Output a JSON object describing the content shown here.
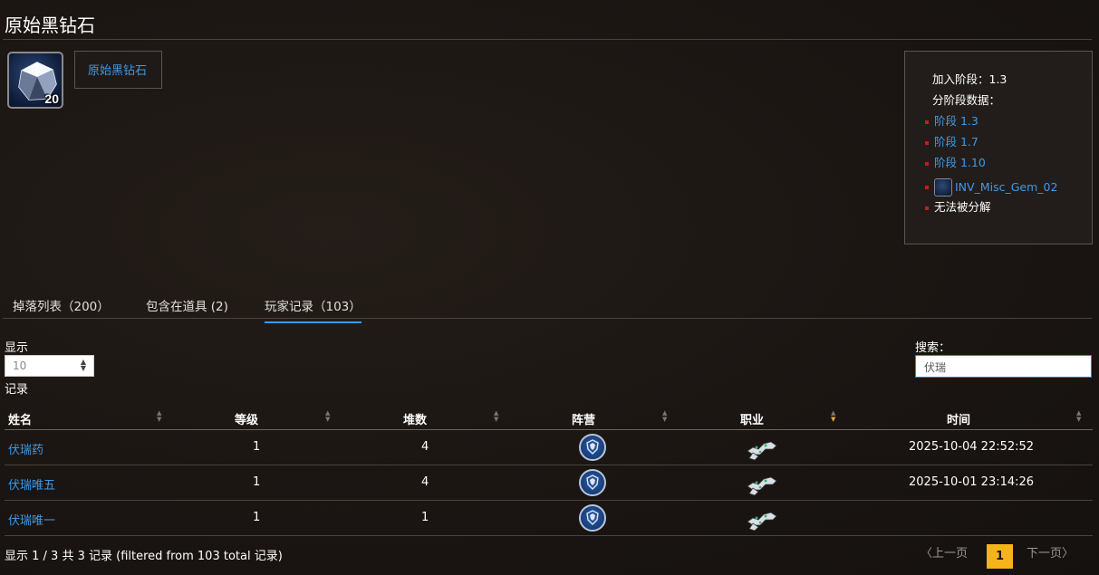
{
  "page_title": "原始黑钻石",
  "item": {
    "stack_count": "20",
    "name": "原始黑钻石",
    "icon": "black-diamond-gem-icon"
  },
  "info": {
    "added_phase": "加入阶段：1.3",
    "phase_data_label": "分阶段数据：",
    "phase_links": [
      "阶段 1.3",
      "阶段 1.7",
      "阶段 1.10"
    ],
    "icon_name": "INV_Misc_Gem_02",
    "cannot_disenchant": "无法被分解"
  },
  "tabs": [
    {
      "label": "掉落列表（200）",
      "active": false
    },
    {
      "label": "包含在道具 (2)",
      "active": false
    },
    {
      "label": "玩家记录（103）",
      "active": true
    }
  ],
  "controls": {
    "show_label": "显示",
    "length_value": "10",
    "records_label": "记录",
    "search_label": "搜索：",
    "search_value": "伏瑞"
  },
  "table": {
    "columns": [
      "姓名",
      "等级",
      "堆数",
      "阵营",
      "职业",
      "时间"
    ],
    "sorted_column": "职业",
    "rows": [
      {
        "name": "伏瑞药",
        "level": "1",
        "stack": "4",
        "faction": "alliance",
        "class": "class-icon",
        "time": "2025-10-04 22:52:52"
      },
      {
        "name": "伏瑞唯五",
        "level": "1",
        "stack": "4",
        "faction": "alliance",
        "class": "class-icon",
        "time": "2025-10-01 23:14:26"
      },
      {
        "name": "伏瑞唯一",
        "level": "1",
        "stack": "1",
        "faction": "alliance",
        "class": "class-icon",
        "time": ""
      }
    ]
  },
  "footer": {
    "info": "显示 1 / 3 共 3 记录 (filtered from 103 total 记录)",
    "prev": "上一页",
    "current_page": "1",
    "next": "下一页"
  },
  "colors": {
    "link": "#3d9ae8",
    "active_tab_underline": "#3d9ae8",
    "current_page_bg": "#f4b41a",
    "bullet": "#c81b1b",
    "sort_active": "#e8a23a"
  }
}
